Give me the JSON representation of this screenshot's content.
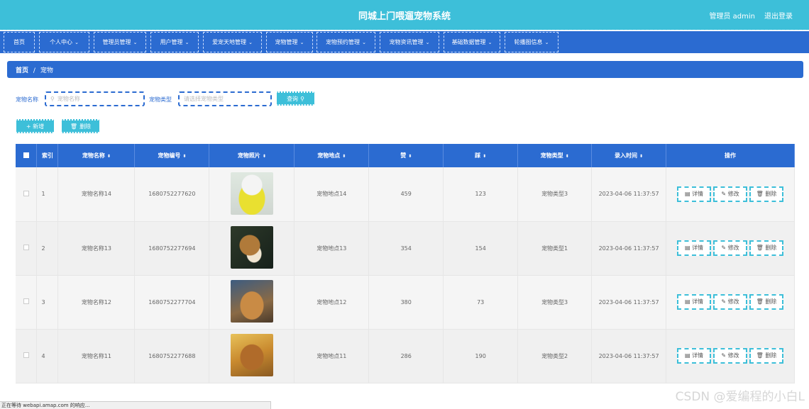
{
  "header": {
    "title": "同城上门喂遛宠物系统",
    "admin": "管理员 admin",
    "logout": "退出登录"
  },
  "nav": [
    {
      "label": "首页",
      "chev": false
    },
    {
      "label": "个人中心",
      "chev": true
    },
    {
      "label": "管理员管理",
      "chev": true
    },
    {
      "label": "用户管理",
      "chev": true
    },
    {
      "label": "爱宠天地管理",
      "chev": true
    },
    {
      "label": "宠物管理",
      "chev": true
    },
    {
      "label": "宠物预约管理",
      "chev": true
    },
    {
      "label": "宠物资讯管理",
      "chev": true
    },
    {
      "label": "基础数据管理",
      "chev": true
    },
    {
      "label": "轮播图信息",
      "chev": true
    }
  ],
  "breadcrumb": {
    "home": "首页",
    "sep": "/",
    "current": "宠物"
  },
  "search": {
    "name_label": "宠物名称",
    "name_placeholder": "宠物名称",
    "type_label": "宠物类型",
    "type_placeholder": "请选择宠物类型",
    "query": "查询"
  },
  "actions": {
    "add": "+ 新增",
    "delete": "删除"
  },
  "table": {
    "headers": [
      "索引",
      "宠物名称",
      "宠物编号",
      "宠物照片",
      "宠物地点",
      "赞",
      "踩",
      "宠物类型",
      "录入时间",
      "操作"
    ],
    "rows": [
      {
        "index": "1",
        "name": "宠物名称14",
        "code": "1680752277620",
        "place": "宠物地点14",
        "like": "459",
        "dislike": "123",
        "type": "宠物类型3",
        "time": "2023-04-06 11:37:57",
        "photo": "white-dog-yellow-shirt"
      },
      {
        "index": "2",
        "name": "宠物名称13",
        "code": "1680752277694",
        "place": "宠物地点13",
        "like": "354",
        "dislike": "154",
        "type": "宠物类型1",
        "time": "2023-04-06 11:37:57",
        "photo": "collie-dog"
      },
      {
        "index": "3",
        "name": "宠物名称12",
        "code": "1680752277704",
        "place": "宠物地点12",
        "like": "380",
        "dislike": "73",
        "type": "宠物类型3",
        "time": "2023-04-06 11:37:57",
        "photo": "dog-blue-flowers"
      },
      {
        "index": "4",
        "name": "宠物名称11",
        "code": "1680752277688",
        "place": "宠物地点11",
        "like": "286",
        "dislike": "190",
        "type": "宠物类型2",
        "time": "2023-04-06 11:37:57",
        "photo": "dog-autumn-leaves"
      }
    ],
    "ops": {
      "detail": "详情",
      "edit": "修改",
      "del": "删除"
    }
  },
  "status_bar": "正在等待 webapi.amap.com 的响应...",
  "watermark": "CSDN @爱编程的小白L",
  "colors": {
    "teal": "#3dbfd9",
    "blue": "#2b6bd1"
  }
}
